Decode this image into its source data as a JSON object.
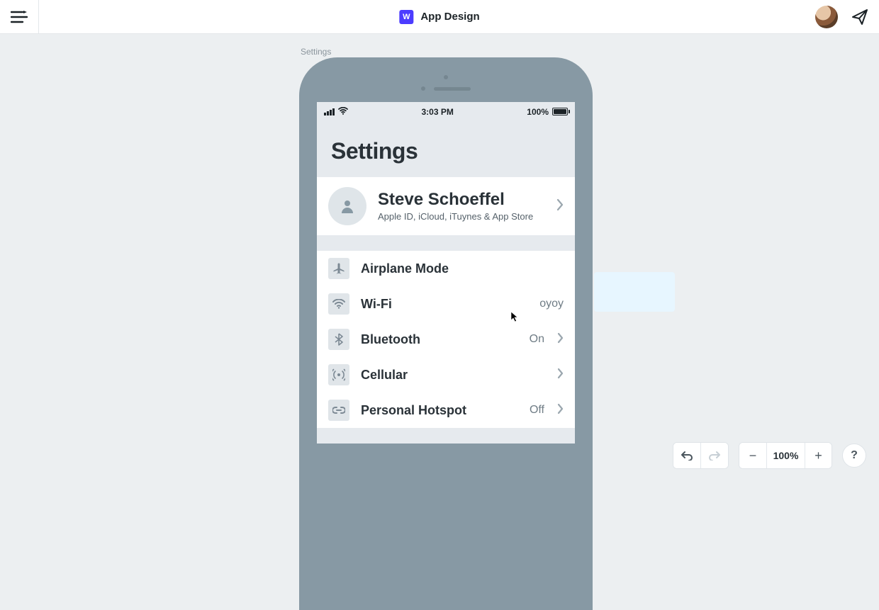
{
  "header": {
    "badge_letter": "W",
    "title": "App Design"
  },
  "canvas": {
    "artboard_label": "Settings"
  },
  "phone": {
    "status": {
      "time": "3:03 PM",
      "battery_pct": "100%"
    },
    "page_title": "Settings",
    "profile": {
      "name": "Steve Schoeffel",
      "subtitle": "Apple ID, iCloud, iTuynes & App Store"
    },
    "rows": [
      {
        "icon": "airplane-icon",
        "label": "Airplane Mode",
        "value": "",
        "chevron": false
      },
      {
        "icon": "wifi-icon",
        "label": "Wi-Fi",
        "value": "oyoy",
        "chevron": false
      },
      {
        "icon": "bluetooth-icon",
        "label": "Bluetooth",
        "value": "On",
        "chevron": true
      },
      {
        "icon": "cellular-icon",
        "label": "Cellular",
        "value": "",
        "chevron": true
      },
      {
        "icon": "hotspot-icon",
        "label": "Personal Hotspot",
        "value": "Off",
        "chevron": true
      }
    ]
  },
  "footer": {
    "zoom": "100%",
    "help": "?"
  }
}
